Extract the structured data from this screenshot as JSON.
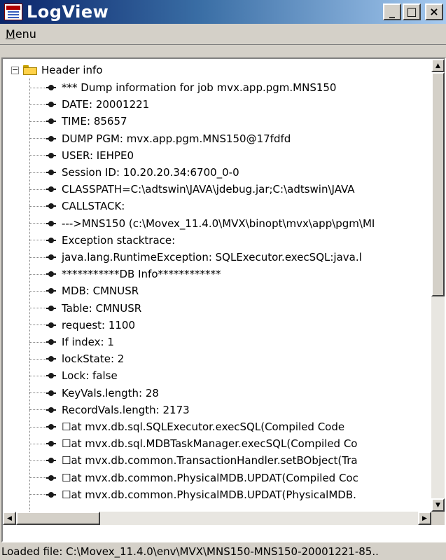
{
  "window": {
    "title": "LogView"
  },
  "menubar": {
    "menu_label": "Menu"
  },
  "tree": {
    "root_label": "Header info",
    "root_expander": "−",
    "items": [
      "*** Dump information for job mvx.app.pgm.MNS150",
      "DATE: 20001221",
      "TIME: 85657",
      "DUMP PGM: mvx.app.pgm.MNS150@17fdfd",
      "USER: IEHPE0",
      "Session ID: 10.20.20.34:6700_0-0",
      "CLASSPATH=C:\\adtswin\\JAVA\\jdebug.jar;C:\\adtswin\\JAVA",
      "CALLSTACK:",
      "--->MNS150 (c:\\Movex_11.4.0\\MVX\\binopt\\mvx\\app\\pgm\\MI",
      "Exception stacktrace:",
      "java.lang.RuntimeException: SQLExecutor.execSQL:java.l",
      "***********DB Info************",
      "MDB: CMNUSR",
      "Table: CMNUSR",
      "request: 1100",
      "If index: 1",
      "lockState: 2",
      "Lock: false",
      "KeyVals.length: 28",
      "RecordVals.length: 2173",
      "☐at mvx.db.sql.SQLExecutor.execSQL(Compiled Code",
      "☐at mvx.db.sql.MDBTaskManager.execSQL(Compiled Co",
      "☐at mvx.db.common.TransactionHandler.setBObject(Tra",
      "☐at mvx.db.common.PhysicalMDB.UPDAT(Compiled Coc",
      "☐at mvx.db.common.PhysicalMDB.UPDAT(PhysicalMDB."
    ]
  },
  "scroll": {
    "up": "▲",
    "down": "▼",
    "left": "◀",
    "right": "▶"
  },
  "window_buttons": {
    "minimize": "_",
    "maximize": "□",
    "close": "×"
  },
  "status": {
    "text": "Loaded file: C:\\Movex_11.4.0\\env\\MVX\\MNS150-MNS150-20001221-85.."
  }
}
